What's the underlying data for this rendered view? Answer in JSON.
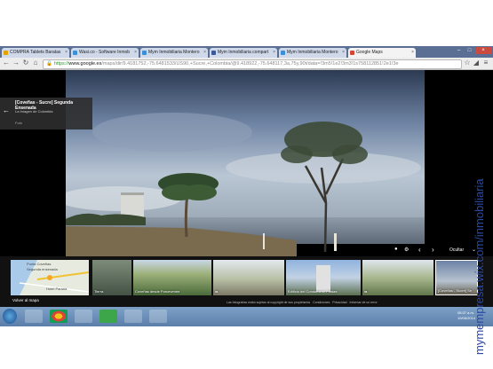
{
  "tabs": [
    {
      "label": "COMPRA Tablets Baratas",
      "fav": "#e5a100"
    },
    {
      "label": "Wasi.co - Software Inmob",
      "fav": "#3b8fd6"
    },
    {
      "label": "Mym Inmobiliaria Montero",
      "fav": "#3b8fd6"
    },
    {
      "label": "Mym Inmobiliaria compart",
      "fav": "#3b5998"
    },
    {
      "label": "Mym Inmobiliaria Montero",
      "fav": "#3b8fd6"
    },
    {
      "label": "Google Maps",
      "fav": "#d44638"
    }
  ],
  "address": {
    "scheme": "https://",
    "host": "www.google.es",
    "path": "/maps/dir/9.4181752,-75.6481533/US90,+Sucre,+Colombia/@9.418922,-75.648117,3a,75y,90t/data=!3m5!1e2!3m3!1s758112851!2e1!3e"
  },
  "infocard": {
    "title": "[Coveñas - Sucre] Segunda Ensenada",
    "subtitle": "La Imagen de Colombia",
    "meta": "Foto"
  },
  "controls": {
    "hide": "Ocultar"
  },
  "filmstrip": {
    "back_to_map": "Volver al mapa",
    "minimap_label_1": "Punta Coveñas",
    "minimap_label_2": "Segunda ensenada",
    "minimap_label_3": "Hotel Parana",
    "thumbs": [
      {
        "caption": "Tierra"
      },
      {
        "caption": "Coveñas desde Porceventre"
      },
      {
        "caption": ""
      },
      {
        "caption": "Edificio del Condominio Puntae"
      },
      {
        "caption": ""
      },
      {
        "caption": "[Coveñas - Sucre] Se"
      }
    ]
  },
  "footer": {
    "copyright": "Las fotografías están sujetas al copyright de sus propietarios",
    "links": [
      "Condiciones",
      "Privacidad",
      "Informar de un error"
    ]
  },
  "taskbar": {
    "time": "08:37 a.m.",
    "date": "10/06/2014"
  },
  "watermark": "mymempresa.wix.com/inmobiliaria"
}
